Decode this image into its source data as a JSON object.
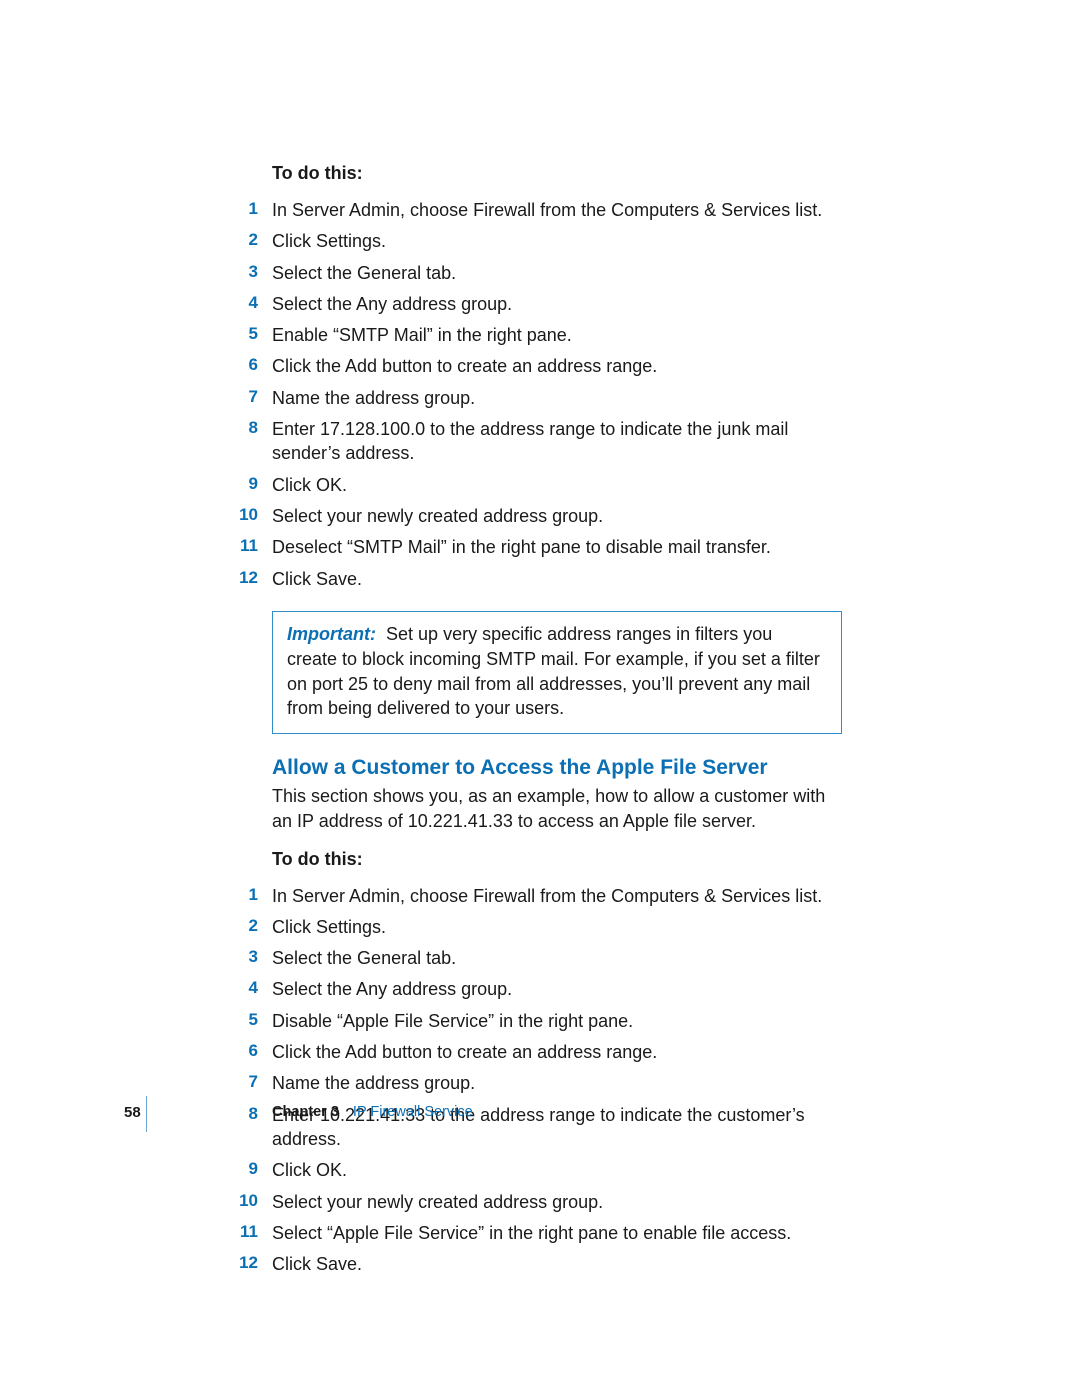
{
  "section1": {
    "lead": "To do this:",
    "steps": [
      "In Server Admin, choose Firewall from the Computers & Services list.",
      "Click Settings.",
      "Select the General tab.",
      "Select the Any address group.",
      "Enable “SMTP Mail” in the right pane.",
      "Click the Add button to create an address range.",
      "Name the address group.",
      "Enter 17.128.100.0 to the address range to indicate the junk mail sender’s address.",
      "Click OK.",
      "Select your newly created address group.",
      "Deselect “SMTP Mail” in the right pane to disable mail transfer.",
      "Click Save."
    ]
  },
  "important": {
    "label": "Important:",
    "text": "Set up very specific address ranges in filters you create to block incoming SMTP mail. For example, if you set a filter on port 25 to deny mail from all addresses, you’ll prevent any mail from being delivered to your users."
  },
  "section2": {
    "heading": "Allow a Customer to Access the Apple File Server",
    "intro": "This section shows you, as an example, how to allow a customer with an IP address of 10.221.41.33 to access an Apple file server.",
    "lead": "To do this:",
    "steps": [
      "In Server Admin, choose Firewall from the Computers & Services list.",
      "Click Settings.",
      "Select the General tab.",
      "Select the Any address group.",
      "Disable “Apple File Service” in the right pane.",
      "Click the Add button to create an address range.",
      "Name the address group.",
      "Enter 10.221.41.33 to the address range to indicate the customer’s address.",
      "Click OK.",
      "Select your newly created address group.",
      "Select “Apple File Service” in the right pane to enable file access.",
      "Click Save."
    ]
  },
  "footer": {
    "page": "58",
    "chapter_label": "Chapter 3",
    "chapter_title": "IP Firewall Service"
  }
}
